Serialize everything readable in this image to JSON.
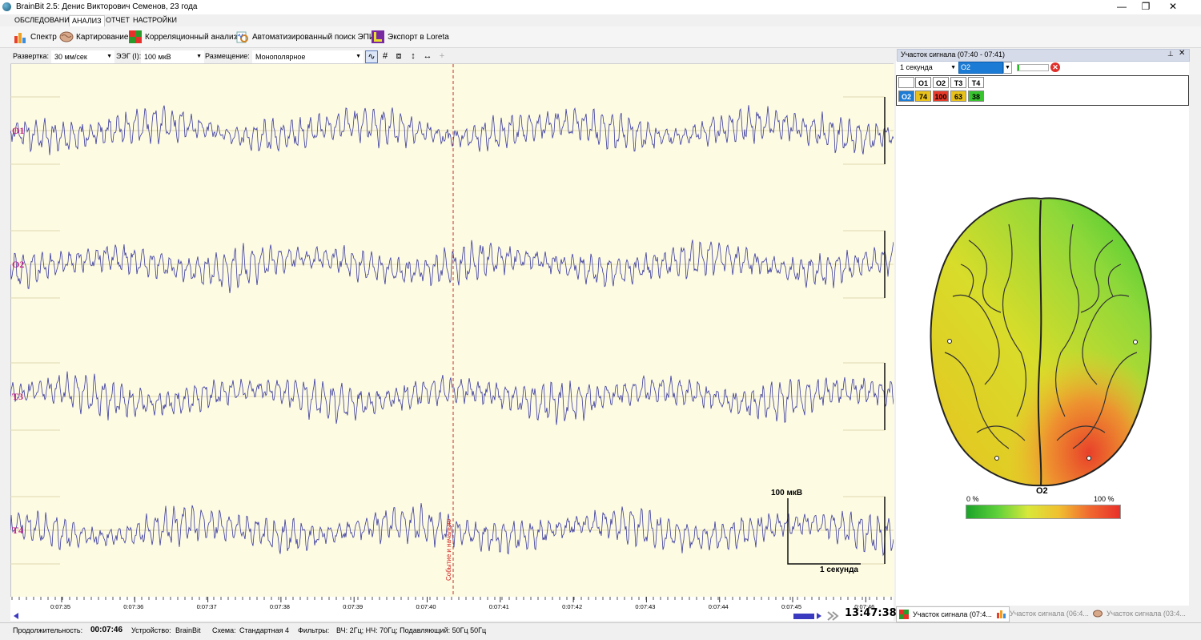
{
  "window": {
    "title": "BrainBit 2.5: Денис Викторович Семенов, 23 года",
    "minimize": "—",
    "restore": "❐",
    "close": "✕"
  },
  "tabs": [
    {
      "label": "ОБСЛЕДОВАНИЕ"
    },
    {
      "label": "АНАЛИЗ"
    },
    {
      "label": "ОТЧЕТ"
    },
    {
      "label": "НАСТРОЙКИ"
    }
  ],
  "ribbon": {
    "spectrum": "Спектр",
    "mapping": "Картирование",
    "correlation": "Корреляционный анализ",
    "epi_search": "Автоматизированный поиск ЭПИ",
    "loreta": "Экспорт в Loreta"
  },
  "eeg_toolbar": {
    "sweep_label": "Развертка:",
    "sweep_value": "30 мм/сек",
    "eeg_label": "ЭЭГ (I):",
    "eeg_value": "100 мкВ",
    "placement_label": "Размещение:",
    "placement_value": "Монополярное"
  },
  "channels": [
    {
      "name": "O1"
    },
    {
      "name": "O2"
    },
    {
      "name": "T3"
    },
    {
      "name": "T4"
    }
  ],
  "event_label": "Событие и начально",
  "scale": {
    "amplitude": "100 мкВ",
    "duration": "1 секунда"
  },
  "timeline": {
    "ticks": [
      "0:07:35",
      "0:07:36",
      "0:07:37",
      "0:07:38",
      "0:07:39",
      "0:07:40",
      "0:07:41",
      "0:07:42",
      "0:07:43",
      "0:07:44",
      "0:07:45",
      "0:07:46"
    ],
    "clock": "13:47:38"
  },
  "right_panel": {
    "title": "Участок сигнала (07:40 - 07:41)",
    "pin": "📌",
    "close": "✕",
    "period": "1 секунда",
    "channel": "O2",
    "progress": 0.06,
    "clear": "✕",
    "correlation": {
      "headers": [
        "O1",
        "O2",
        "T3",
        "T4"
      ],
      "row_label": "O2",
      "values": [
        "74",
        "100",
        "63",
        "38"
      ],
      "colors": [
        "#e8c21a",
        "#e83a2a",
        "#e8c21a",
        "#37c42e"
      ]
    },
    "map_channel": "O2",
    "scale_min": "0 %",
    "scale_max": "100 %"
  },
  "bottom_tabs": [
    {
      "label": "Участок сигнала (07:4..."
    },
    {
      "label": "Участок сигнала (06:4..."
    },
    {
      "label": "Участок сигнала (03:4..."
    }
  ],
  "status": {
    "duration_label": "Продолжительность:",
    "duration_value": "00:07:46",
    "device_label": "Устройство:",
    "device_value": "BrainBit",
    "scheme_label": "Схема:",
    "scheme_value": "Стандартная 4",
    "filters_label": "Фильтры:",
    "filters_value": "ВЧ: 2Гц; НЧ: 70Гц; Подавляющий: 50Гц 50Гц"
  }
}
